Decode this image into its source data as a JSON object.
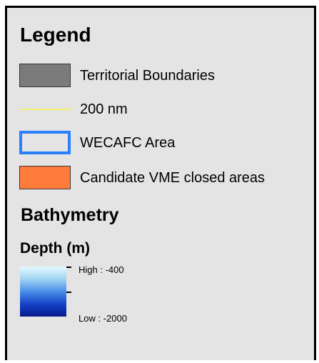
{
  "legend": {
    "title": "Legend",
    "items": [
      {
        "label": "Territorial Boundaries",
        "symbol": "gray-hatched-fill"
      },
      {
        "label": "200 nm",
        "symbol": "yellow-line",
        "color": "#f4f06a"
      },
      {
        "label": "WECAFC Area",
        "symbol": "blue-outline",
        "color": "#2a7fff"
      },
      {
        "label": "Candidate VME closed areas",
        "symbol": "orange-fill",
        "color": "#ff7b3a"
      }
    ],
    "bathymetry": {
      "title": "Bathymetry",
      "depth_title": "Depth (m)",
      "high_label": "High : -400",
      "low_label": "Low : -2000",
      "gradient_colors": [
        "#e6faff",
        "#9fd4f3",
        "#4a8ee8",
        "#1542c8",
        "#061a8a"
      ]
    }
  }
}
